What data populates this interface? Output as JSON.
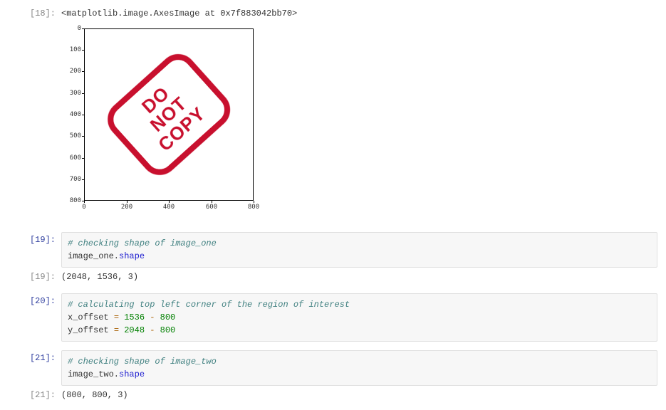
{
  "cells": {
    "c18": {
      "in_prompt": "[18]:",
      "out_text": "<matplotlib.image.AxesImage at 0x7f883042bb70>"
    },
    "c19": {
      "in_prompt": "[19]:",
      "comment": "# checking shape of image_one",
      "line2a": "image_one.",
      "line2b": "shape",
      "out_prompt": "[19]:",
      "out_text": "(2048, 1536, 3)"
    },
    "c20": {
      "in_prompt": "[20]:",
      "comment": "# calculating top left corner of the region of interest",
      "l2_lhs": "x_offset ",
      "l2_eq": "=",
      "l2_sp": " ",
      "l2_n1": "1536",
      "l2_op": " - ",
      "l2_n2": "800",
      "l3_lhs": "y_offset ",
      "l3_eq": "=",
      "l3_sp": " ",
      "l3_n1": "2048",
      "l3_op": " - ",
      "l3_n2": "800"
    },
    "c21": {
      "in_prompt": "[21]:",
      "comment": "# checking shape of image_two",
      "line2a": "image_two.",
      "line2b": "shape",
      "out_prompt": "[21]:",
      "out_text": "(800, 800, 3)"
    }
  },
  "stamp": {
    "l1": "DO NOT",
    "l2": "COPY"
  },
  "chart_data": {
    "type": "image",
    "title": "",
    "xlabel": "",
    "ylabel": "",
    "xlim": [
      0,
      800
    ],
    "ylim": [
      800,
      0
    ],
    "xticks": [
      0,
      200,
      400,
      600,
      800
    ],
    "yticks": [
      0,
      100,
      200,
      300,
      400,
      500,
      600,
      700,
      800
    ],
    "description": "800x800 rendered image containing a red rotated 'DO NOT COPY' stamp on white background"
  }
}
